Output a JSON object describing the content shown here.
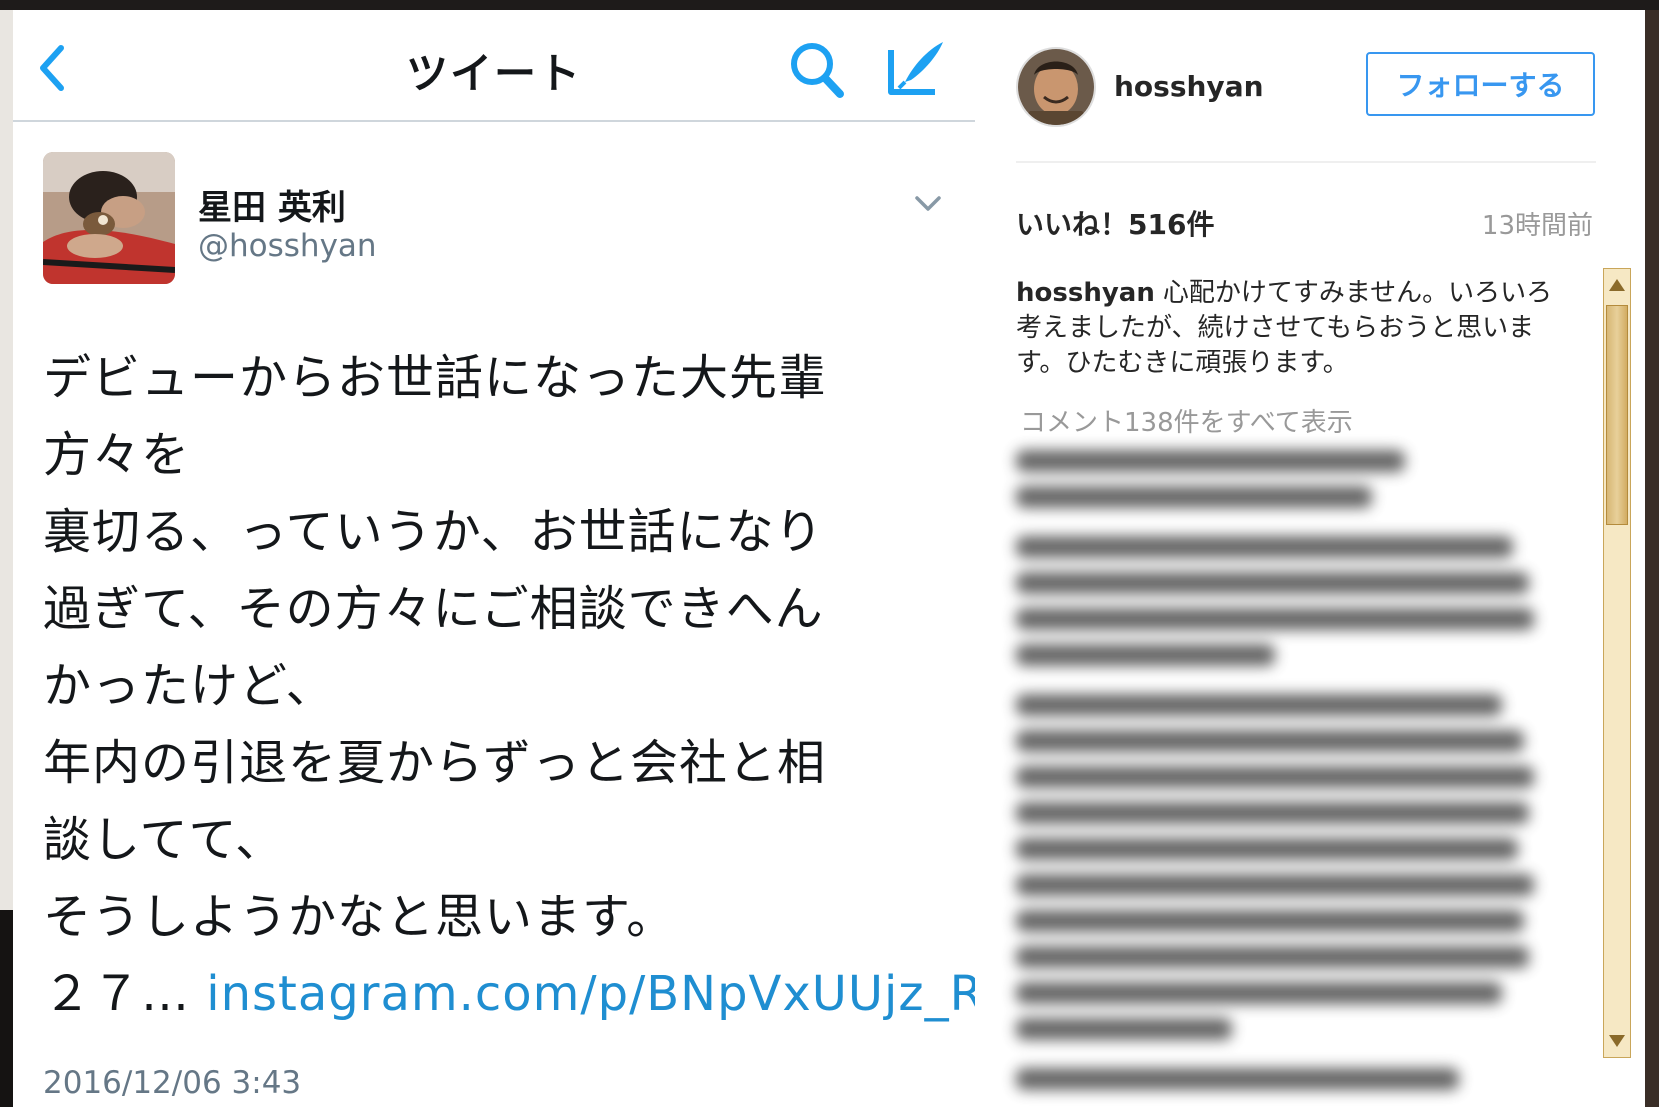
{
  "twitter": {
    "header": {
      "title": "ツイート",
      "back_icon": "chevron-left-icon",
      "search_icon": "search-icon",
      "compose_icon": "compose-icon"
    },
    "author": {
      "name": "星田 英利",
      "handle": "@hosshyan"
    },
    "body": {
      "lines": [
        "デビューからお世話になった大先輩",
        "方々を",
        "裏切る、っていうか、お世話になり",
        "過ぎて、その方々にご相談できへん",
        "かったけど、",
        "年内の引退を夏からずっと会社と相",
        "談してて、",
        "そうしようかなと思います。"
      ],
      "last_prefix": "２７…",
      "link": "instagram.com/p/BNpVxUUjz_R/"
    },
    "timestamp": "2016/12/06 3:43",
    "colors": {
      "link": "#1f8ed1",
      "accent": "#1da1f2"
    }
  },
  "instagram": {
    "username": "hosshyan",
    "follow_label": "フォローする",
    "likes": "いいね！516件",
    "time_ago": "13時間前",
    "caption": {
      "user": "hosshyan",
      "text": "心配かけてすみません。いろいろ考えましたが、続けさせてもらおうと思います。ひたむきに頑張ります。"
    },
    "view_all_comments": "コメント138件をすべて表示",
    "colors": {
      "follow": "#3897f0"
    }
  }
}
